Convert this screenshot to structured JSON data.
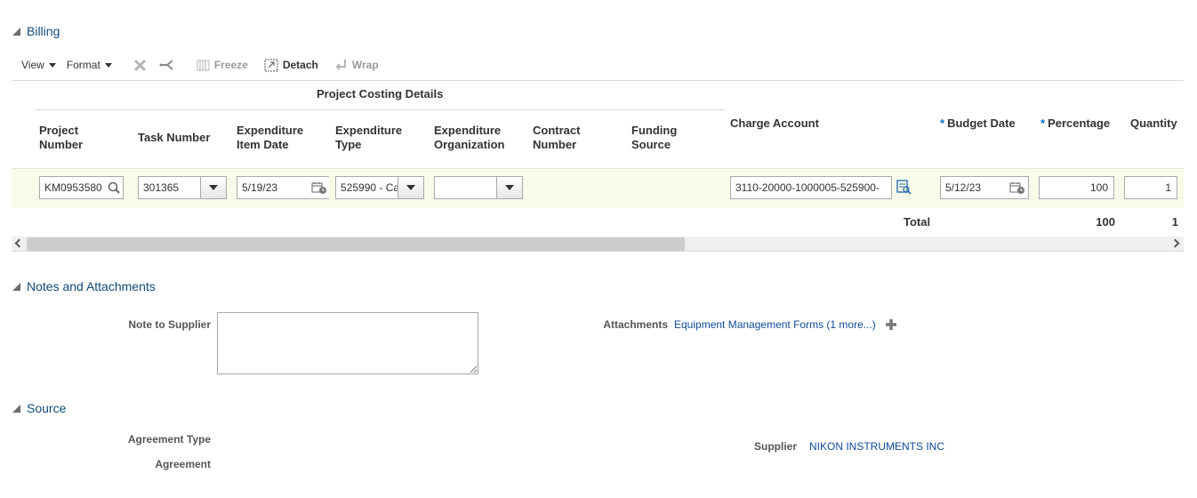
{
  "billing": {
    "title": "Billing",
    "toolbar": {
      "view_label": "View",
      "format_label": "Format",
      "freeze_label": "Freeze",
      "detach_label": "Detach",
      "wrap_label": "Wrap"
    },
    "group_header": "Project Costing Details",
    "columns": {
      "project_number": "Project Number",
      "task_number": "Task Number",
      "expenditure_item_date": "Expenditure Item Date",
      "expenditure_type": "Expenditure Type",
      "expenditure_organization": "Expenditure Organization",
      "contract_number": "Contract Number",
      "funding_source": "Funding Source",
      "charge_account": "Charge Account",
      "budget_date": "Budget Date",
      "percentage": "Percentage",
      "quantity": "Quantity"
    },
    "required_marker": "*",
    "row": {
      "project_number": "KM0953580",
      "task_number": "301365",
      "expenditure_item_date": "5/19/23",
      "expenditure_type": "525990 - Ca",
      "expenditure_organization": "",
      "charge_account": "3110-20000-1000005-525900-",
      "budget_date": "5/12/23",
      "percentage": "100",
      "quantity": "1"
    },
    "total": {
      "label": "Total",
      "percentage": "100",
      "quantity": "1"
    }
  },
  "notes": {
    "title": "Notes and Attachments",
    "note_to_supplier_label": "Note to Supplier",
    "note_to_supplier_value": "",
    "attachments_label": "Attachments",
    "attachments_link": "Equipment Management Forms (1 more...)"
  },
  "source": {
    "title": "Source",
    "agreement_type_label": "Agreement Type",
    "agreement_label": "Agreement",
    "supplier_label": "Supplier",
    "supplier_value": "NIKON INSTRUMENTS INC"
  },
  "colors": {
    "section_title": "#0f4a7a",
    "link": "#0f4a9a",
    "row_highlight": "#f8fbe9",
    "required": "#0572ce"
  }
}
